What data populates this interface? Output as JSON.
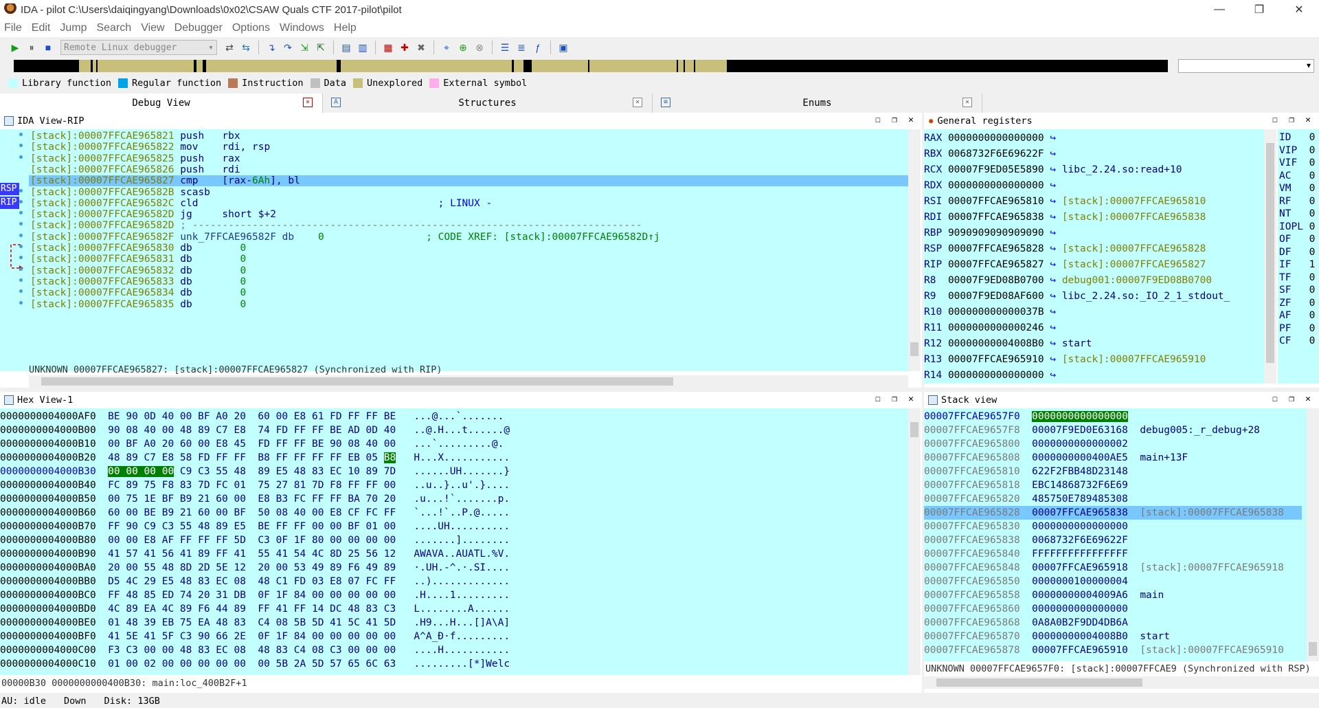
{
  "window": {
    "title": "IDA - pilot C:\\Users\\daiqingyang\\Downloads\\0x02\\CSAW Quals CTF 2017-pilot\\pilot"
  },
  "menu": [
    "File",
    "Edit",
    "Jump",
    "Search",
    "View",
    "Debugger",
    "Options",
    "Windows",
    "Help"
  ],
  "toolbar": {
    "debugger_select": "Remote Linux debugger"
  },
  "legend": [
    {
      "label": "Library function",
      "color": "#c2ffff"
    },
    {
      "label": "Regular function",
      "color": "#00a2e8"
    },
    {
      "label": "Instruction",
      "color": "#b97a57"
    },
    {
      "label": "Data",
      "color": "#c0c0c0"
    },
    {
      "label": "Unexplored",
      "color": "#c8c07a"
    },
    {
      "label": "External symbol",
      "color": "#ffaee9"
    }
  ],
  "tabs": [
    {
      "label": "Debug View"
    },
    {
      "label": "Structures",
      "icon": "A"
    },
    {
      "label": "Enums",
      "icon": "≡"
    }
  ],
  "idaview": {
    "title": "IDA View-RIP",
    "rsp_tag": "RSP",
    "rip_tag": "RIP",
    "lines": [
      {
        "addr": "[stack]:00007FFCAE965821",
        "mn": "push",
        "op": "rbx",
        "cm": ""
      },
      {
        "addr": "[stack]:00007FFCAE965822",
        "mn": "mov",
        "op": "rdi, rsp",
        "cm": ""
      },
      {
        "addr": "[stack]:00007FFCAE965825",
        "mn": "push",
        "op": "rax",
        "cm": ""
      },
      {
        "addr": "[stack]:00007FFCAE965826",
        "mn": "push",
        "op": "rdi",
        "cm": ""
      },
      {
        "addr": "[stack]:00007FFCAE965827",
        "mn": "cmp",
        "op": "[rax-6Ah], bl",
        "cm": ""
      },
      {
        "addr": "[stack]:00007FFCAE96582B",
        "mn": "scasb",
        "op": "",
        "cm": ""
      },
      {
        "addr": "[stack]:00007FFCAE96582C",
        "mn": "cld",
        "op": "",
        "cm": "; LINUX -"
      },
      {
        "addr": "[stack]:00007FFCAE96582D",
        "mn": "jg",
        "op": "short $+2",
        "cm": ""
      },
      {
        "addr": "[stack]:00007FFCAE96582D",
        "mn": "; ---------------------------------------------------------------------------",
        "op": "",
        "cm": ""
      },
      {
        "addr": "[stack]:00007FFCAE96582F",
        "mn": "unk_7FFCAE96582F db",
        "op": "0",
        "cm": "; CODE XREF: [stack]:00007FFCAE96582D↑j"
      },
      {
        "addr": "[stack]:00007FFCAE965830",
        "mn": "db",
        "op": "0",
        "cm": ""
      },
      {
        "addr": "[stack]:00007FFCAE965831",
        "mn": "db",
        "op": "0",
        "cm": ""
      },
      {
        "addr": "[stack]:00007FFCAE965832",
        "mn": "db",
        "op": "0",
        "cm": ""
      },
      {
        "addr": "[stack]:00007FFCAE965833",
        "mn": "db",
        "op": "0",
        "cm": ""
      },
      {
        "addr": "[stack]:00007FFCAE965834",
        "mn": "db",
        "op": "0",
        "cm": ""
      },
      {
        "addr": "[stack]:00007FFCAE965835",
        "mn": "db",
        "op": "0",
        "cm": ""
      }
    ],
    "status": "UNKNOWN 00007FFCAE965827: [stack]:00007FFCAE965827 (Synchronized with RIP)"
  },
  "registers": {
    "title": "General registers",
    "rows": [
      {
        "name": "RAX",
        "value": "0000000000000000",
        "ref": ""
      },
      {
        "name": "RBX",
        "value": "0068732F6E69622F",
        "ref": ""
      },
      {
        "name": "RCX",
        "value": "00007F9ED05E5890",
        "ref": "libc_2.24.so:read+10"
      },
      {
        "name": "RDX",
        "value": "0000000000000000",
        "ref": ""
      },
      {
        "name": "RSI",
        "value": "00007FFCAE965810",
        "ref": "[stack]:00007FFCAE965810"
      },
      {
        "name": "RDI",
        "value": "00007FFCAE965838",
        "ref": "[stack]:00007FFCAE965838"
      },
      {
        "name": "RBP",
        "value": "9090909090909090",
        "ref": ""
      },
      {
        "name": "RSP",
        "value": "00007FFCAE965828",
        "ref": "[stack]:00007FFCAE965828"
      },
      {
        "name": "RIP",
        "value": "00007FFCAE965827",
        "ref": "[stack]:00007FFCAE965827"
      },
      {
        "name": "R8",
        "value": "00007F9ED08B0700",
        "ref": "debug001:00007F9ED08B0700"
      },
      {
        "name": "R9",
        "value": "00007F9ED08AF600",
        "ref": "libc_2.24.so:_IO_2_1_stdout_"
      },
      {
        "name": "R10",
        "value": "000000000000037B",
        "ref": ""
      },
      {
        "name": "R11",
        "value": "0000000000000246",
        "ref": ""
      },
      {
        "name": "R12",
        "value": "00000000004008B0",
        "ref": "start"
      },
      {
        "name": "R13",
        "value": "00007FFCAE965910",
        "ref": "[stack]:00007FFCAE965910"
      },
      {
        "name": "R14",
        "value": "0000000000000000",
        "ref": ""
      }
    ],
    "flags": [
      {
        "name": "ID",
        "v": "0"
      },
      {
        "name": "VIP",
        "v": "0"
      },
      {
        "name": "VIF",
        "v": "0"
      },
      {
        "name": "AC",
        "v": "0"
      },
      {
        "name": "VM",
        "v": "0"
      },
      {
        "name": "RF",
        "v": "0"
      },
      {
        "name": "NT",
        "v": "0"
      },
      {
        "name": "IOPL",
        "v": "0"
      },
      {
        "name": "OF",
        "v": "0"
      },
      {
        "name": "DF",
        "v": "0"
      },
      {
        "name": "IF",
        "v": "1"
      },
      {
        "name": "TF",
        "v": "0"
      },
      {
        "name": "SF",
        "v": "0"
      },
      {
        "name": "ZF",
        "v": "0"
      },
      {
        "name": "AF",
        "v": "0"
      },
      {
        "name": "PF",
        "v": "0"
      },
      {
        "name": "CF",
        "v": "0"
      }
    ]
  },
  "hexview": {
    "title": "Hex View-1",
    "rows": [
      {
        "addr": "00000000004000AF0",
        "bytes": "BE 90 0D 40 00 BF A0 20  60 00 E8 61 FD FF FF BE",
        "ascii": "...@...`......."
      },
      {
        "addr": "00000000004000B00",
        "bytes": "90 08 40 00 48 89 C7 E8  74 FD FF FF BE AD 0D 40",
        "ascii": "..@.H...t......@"
      },
      {
        "addr": "00000000004000B10",
        "bytes": "00 BF A0 20 60 00 E8 45  FD FF FF BE 90 08 40 00",
        "ascii": "...`.........@."
      },
      {
        "addr": "00000000004000B20",
        "bytes": "48 89 C7 E8 58 FD FF FF  B8 FF FF FF FF EB 05 B8",
        "ascii": "H...X..........."
      },
      {
        "addr": "00000000004000B30",
        "bytes": "00 00 00 00 C9 C3 55 48  89 E5 48 83 EC 10 89 7D",
        "ascii": "......UH.......}"
      },
      {
        "addr": "00000000004000B40",
        "bytes": "FC 89 75 F8 83 7D FC 01  75 27 81 7D F8 FF FF 00",
        "ascii": "..u..}..u'.}...."
      },
      {
        "addr": "00000000004000B50",
        "bytes": "00 75 1E BF B9 21 60 00  E8 B3 FC FF FF BA 70 20",
        "ascii": ".u...!`.......p."
      },
      {
        "addr": "00000000004000B60",
        "bytes": "60 00 BE B9 21 60 00 BF  50 08 40 00 E8 CF FC FF",
        "ascii": "`...!`..P.@....."
      },
      {
        "addr": "00000000004000B70",
        "bytes": "FF 90 C9 C3 55 48 89 E5  BE FF FF 00 00 BF 01 00",
        "ascii": "....UH.........."
      },
      {
        "addr": "00000000004000B80",
        "bytes": "00 00 E8 AF FF FF FF 5D  C3 0F 1F 80 00 00 00 00",
        "ascii": ".......]........"
      },
      {
        "addr": "00000000004000B90",
        "bytes": "41 57 41 56 41 89 FF 41  55 41 54 4C 8D 25 56 12",
        "ascii": "AWAVA..AUATL.%V."
      },
      {
        "addr": "00000000004000BA0",
        "bytes": "20 00 55 48 8D 2D 5E 12  20 00 53 49 89 F6 49 89",
        "ascii": "·.UH.-^.·.SI...."
      },
      {
        "addr": "00000000004000BB0",
        "bytes": "D5 4C 29 E5 48 83 EC 08  48 C1 FD 03 E8 07 FC FF",
        "ascii": "..)............."
      },
      {
        "addr": "00000000004000BC0",
        "bytes": "FF 48 85 ED 74 20 31 DB  0F 1F 84 00 00 00 00 00",
        "ascii": ".H....1........."
      },
      {
        "addr": "00000000004000BD0",
        "bytes": "4C 89 EA 4C 89 F6 44 89  FF 41 FF 14 DC 48 83 C3",
        "ascii": "L........A......"
      },
      {
        "addr": "00000000004000BE0",
        "bytes": "01 48 39 EB 75 EA 48 83  C4 08 5B 5D 41 5C 41 5D",
        "ascii": ".H9...H...[]A\\A]"
      },
      {
        "addr": "00000000004000BF0",
        "bytes": "41 5E 41 5F C3 90 66 2E  0F 1F 84 00 00 00 00 00",
        "ascii": "A^A_Ð·f........."
      },
      {
        "addr": "00000000004000C00",
        "bytes": "F3 C3 00 00 48 83 EC 08  48 83 C4 08 C3 00 00 00",
        "ascii": "....H..........."
      },
      {
        "addr": "00000000004000C10",
        "bytes": "01 00 02 00 00 00 00 00  00 5B 2A 5D 57 65 6C 63",
        "ascii": ".........[*]Welc"
      }
    ],
    "status": "00000B30 0000000000400B30: main:loc_400B2F+1"
  },
  "stackview": {
    "title": "Stack view",
    "rows": [
      {
        "addr": "00007FFCAE9657F0",
        "val": "0000000000000000",
        "ref": ""
      },
      {
        "addr": "00007FFCAE9657F8",
        "val": "00007F9ED0E63168",
        "ref": "debug005:_r_debug+28"
      },
      {
        "addr": "00007FFCAE965800",
        "val": "0000000000000002",
        "ref": ""
      },
      {
        "addr": "00007FFCAE965808",
        "val": "0000000000400AE5",
        "ref": "main+13F"
      },
      {
        "addr": "00007FFCAE965810",
        "val": "622F2FBB48D23148",
        "ref": ""
      },
      {
        "addr": "00007FFCAE965818",
        "val": "EBC14868732F6E69",
        "ref": ""
      },
      {
        "addr": "00007FFCAE965820",
        "val": "485750E789485308",
        "ref": ""
      },
      {
        "addr": "00007FFCAE965828",
        "val": "00007FFCAE965838",
        "ref": "[stack]:00007FFCAE965838"
      },
      {
        "addr": "00007FFCAE965830",
        "val": "0000000000000000",
        "ref": ""
      },
      {
        "addr": "00007FFCAE965838",
        "val": "0068732F6E69622F",
        "ref": ""
      },
      {
        "addr": "00007FFCAE965840",
        "val": "FFFFFFFFFFFFFFFF",
        "ref": ""
      },
      {
        "addr": "00007FFCAE965848",
        "val": "00007FFCAE965918",
        "ref": "[stack]:00007FFCAE965918"
      },
      {
        "addr": "00007FFCAE965850",
        "val": "0000000100000004",
        "ref": ""
      },
      {
        "addr": "00007FFCAE965858",
        "val": "00000000004009A6",
        "ref": "main"
      },
      {
        "addr": "00007FFCAE965860",
        "val": "0000000000000000",
        "ref": ""
      },
      {
        "addr": "00007FFCAE965868",
        "val": "0A8A0B2F9DD4DB6A",
        "ref": ""
      },
      {
        "addr": "00007FFCAE965870",
        "val": "00000000004008B0",
        "ref": "start"
      },
      {
        "addr": "00007FFCAE965878",
        "val": "00007FFCAE965910",
        "ref": "[stack]:00007FFCAE965910"
      }
    ],
    "status": "UNKNOWN 00007FFCAE9657F0: [stack]:00007FFCAE9 (Synchronized with RSP)"
  },
  "statusbar": {
    "au": "AU:  idle",
    "dir": "Down",
    "disk": "Disk: 13GB"
  }
}
